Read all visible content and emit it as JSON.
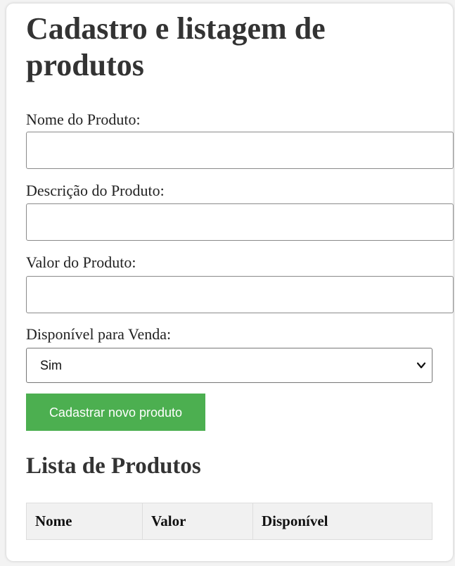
{
  "page": {
    "title": "Cadastro e listagem de produtos"
  },
  "form": {
    "name_label": "Nome do Produto:",
    "name_value": "",
    "description_label": "Descrição do Produto:",
    "description_value": "",
    "price_label": "Valor do Produto:",
    "price_value": "",
    "available_label": "Disponível para Venda:",
    "available_selected": "Sim",
    "submit_label": "Cadastrar novo produto"
  },
  "list": {
    "title": "Lista de Produtos",
    "columns": [
      "Nome",
      "Valor",
      "Disponível"
    ]
  },
  "icons": {
    "select_chevron": "chevron-down-icon"
  },
  "colors": {
    "submit_button": "#4caf50",
    "table_header_bg": "#f1f1f1",
    "text": "#333333"
  }
}
